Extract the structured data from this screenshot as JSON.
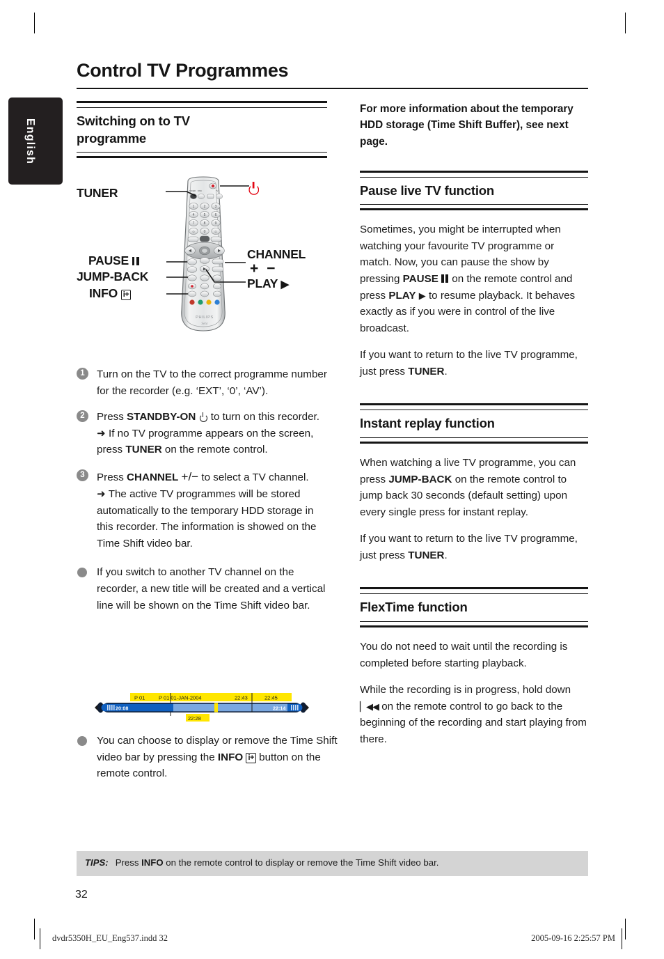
{
  "language_tab": {
    "label": "English"
  },
  "header": {
    "title": "Control TV Programmes"
  },
  "left_column": {
    "section": {
      "title_line1": "Switching on to TV",
      "title_line2": "programme"
    },
    "figure": {
      "name": "philips-remote-control",
      "callouts": {
        "tuner": "TUNER",
        "standby": "standby-power-icon",
        "pause": "PAUSE",
        "jump_back": "JUMP-BACK",
        "info": "INFO",
        "channel": "CHANNEL",
        "channel_plusminus": "+ −",
        "play": "PLAY"
      },
      "brand": "PHILIPS",
      "sub_brand": "Sehr"
    },
    "steps": [
      {
        "num": "1",
        "type": "numbered",
        "text": "Turn on the TV to the correct programme number for the recorder (e.g. ‘EXT’, ‘0’, ‘AV’)."
      },
      {
        "num": "2",
        "type": "numbered",
        "lead": "Press ",
        "bold1": "STANDBY-ON",
        "mid": " to turn on this recorder.",
        "arrow_lead": "If no TV programme appears on the screen, press ",
        "arrow_bold": "TUNER",
        "arrow_tail": " on the remote control."
      },
      {
        "num": "3",
        "type": "numbered",
        "lead": "Press ",
        "bold1": "CHANNEL",
        "plusminus": "+/−",
        "mid": " to select a TV channel.",
        "arrow_text": "The active TV programmes will be stored automatically to the temporary HDD storage in this recorder. The information is showed on the Time Shift video bar."
      },
      {
        "type": "bullet",
        "text": "If you switch to another TV channel on the recorder, a new title will be created and a vertical line will be shown on the Time Shift video bar."
      },
      {
        "type": "bullet",
        "lead": "You can choose to display or remove the Time Shift video bar by pressing the ",
        "bold1": "INFO",
        "info_glyph": "i+",
        "tail": " button on the remote control."
      }
    ],
    "timeshift_bar": {
      "label_p01_a": "P 01",
      "label_p01_b": "P 01 01-JAN-2004",
      "time_start": "20:08",
      "time_marker": "22:28",
      "time_mid1": "22:43",
      "time_mid2": "22:45",
      "time_end": "22:14",
      "colors": {
        "highlight": "#ffe600",
        "bar_dark": "#1060c0",
        "bar_light": "#7aa8e0",
        "bar_outline": "#0b1f3a"
      }
    }
  },
  "right_column": {
    "intro": "For more information about the temporary HDD storage (Time Shift Buffer), see next page.",
    "sections": [
      {
        "title": "Pause live TV function",
        "paragraphs": [
          {
            "parts": [
              {
                "t": "Sometimes, you might be interrupted when watching your favourite TV programme or match. Now, you can pause the show by pressing "
              },
              {
                "t": "PAUSE",
                "bold": true
              },
              {
                "t": " on the remote control and press "
              },
              {
                "t": "PLAY",
                "bold": true
              },
              {
                "t": " to resume playback. It behaves exactly as if you were in control of the live broadcast."
              }
            ]
          },
          {
            "parts": [
              {
                "t": "If you want to return to the live TV programme, just press "
              },
              {
                "t": "TUNER",
                "bold": true
              },
              {
                "t": "."
              }
            ]
          }
        ]
      },
      {
        "title": "Instant replay function",
        "paragraphs": [
          {
            "parts": [
              {
                "t": "When watching a live TV programme, you can press "
              },
              {
                "t": "JUMP-BACK",
                "bold": true
              },
              {
                "t": " on the remote control to jump back 30 seconds (default setting) upon every single press for instant replay."
              }
            ]
          },
          {
            "parts": [
              {
                "t": "If you want to return to the live TV programme, just press "
              },
              {
                "t": "TUNER",
                "bold": true
              },
              {
                "t": "."
              }
            ]
          }
        ]
      },
      {
        "title": "FlexTime function",
        "paragraphs": [
          {
            "parts": [
              {
                "t": "You do not need to wait until the recording is completed before starting playback."
              }
            ]
          },
          {
            "parts": [
              {
                "t": "While the recording is in progress, hold down "
              },
              {
                "t": "▏◀◀",
                "glyph": "prev-track"
              },
              {
                "t": " on the remote control to go back to the beginning of the recording and start playing from there."
              }
            ]
          }
        ]
      }
    ]
  },
  "tips": {
    "label": "TIPS:",
    "lead": "Press ",
    "bold": "INFO",
    "tail": " on the remote control to display or remove the Time Shift video bar."
  },
  "page_number": "32",
  "footer": {
    "left": "dvdr5350H_EU_Eng537.indd   32",
    "right": "2005-09-16   2:25:57 PM"
  }
}
